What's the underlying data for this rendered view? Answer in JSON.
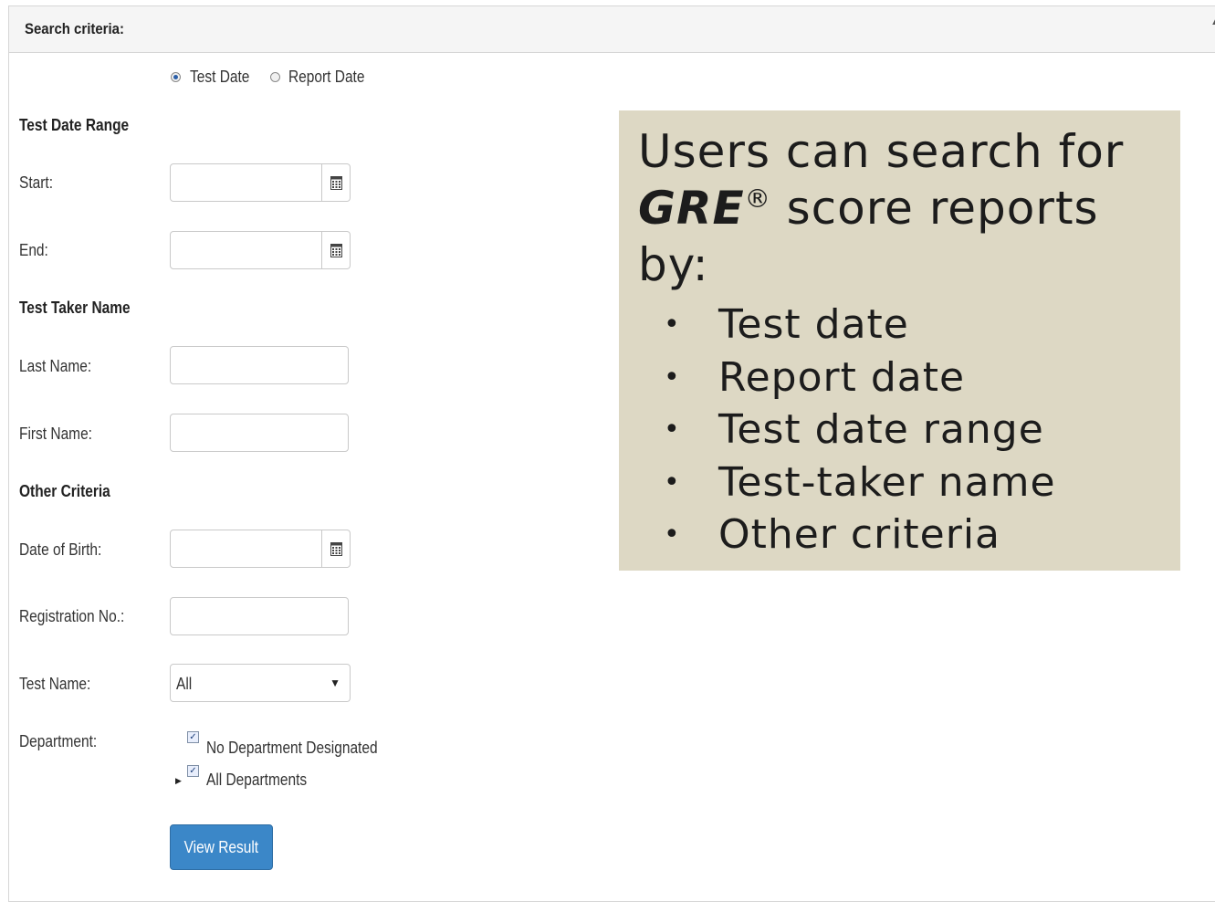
{
  "panel": {
    "title": "Search criteria:",
    "collapse_icon": "caret-up-icon"
  },
  "date_type": {
    "options": [
      {
        "label": "Test Date",
        "selected": true
      },
      {
        "label": "Report Date",
        "selected": false
      }
    ]
  },
  "sections": {
    "test_date_range": "Test Date Range",
    "test_taker_name": "Test Taker Name",
    "other_criteria": "Other Criteria"
  },
  "fields": {
    "start": {
      "label": "Start:",
      "value": "",
      "icon": "calendar-icon"
    },
    "end": {
      "label": "End:",
      "value": "",
      "icon": "calendar-icon"
    },
    "last_name": {
      "label": "Last Name:",
      "value": ""
    },
    "first_name": {
      "label": "First Name:",
      "value": ""
    },
    "date_of_birth": {
      "label": "Date of Birth:",
      "value": "",
      "icon": "calendar-icon"
    },
    "registration_no": {
      "label": "Registration No.:",
      "value": ""
    },
    "test_name": {
      "label": "Test Name:",
      "selected": "All"
    }
  },
  "department": {
    "label": "Department:",
    "items": [
      {
        "label": "No Department Designated",
        "checked": true
      },
      {
        "label": "All Departments",
        "checked": true,
        "expandable": true
      }
    ]
  },
  "actions": {
    "view_result": "View Result"
  },
  "callout": {
    "line1": "Users can search for",
    "brand": "GRE",
    "registered": "®",
    "line2_rest": " score reports",
    "line3": "by:",
    "bullets": [
      "Test date",
      "Report date",
      "Test date range",
      "Test-taker name",
      "Other criteria"
    ]
  }
}
